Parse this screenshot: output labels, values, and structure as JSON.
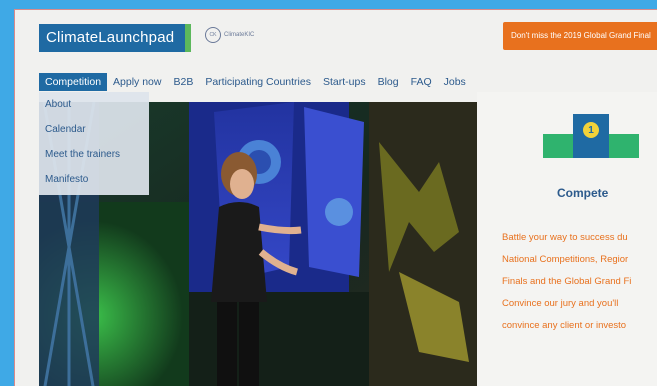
{
  "header": {
    "logo_text": "ClimateLaunchpad",
    "partner_logo_text": "ClimateKIC",
    "promo_text": "Don't miss the 2019 Global Grand Final"
  },
  "nav": {
    "items": [
      "Competition",
      "Apply now",
      "B2B",
      "Participating Countries",
      "Start-ups",
      "Blog",
      "FAQ",
      "Jobs"
    ]
  },
  "dropdown": {
    "items": [
      "About",
      "Calendar",
      "Meet the trainers",
      "Manifesto"
    ]
  },
  "compete": {
    "badge": "1",
    "title": "Compete",
    "description_lines": [
      "Battle your way to success du",
      "National Competitions, Regior",
      "Finals and the Global Grand Fi",
      "Convince our jury and you'll",
      "convince any client or investo"
    ]
  },
  "colors": {
    "background": "#3fa9e6",
    "brand_blue": "#1f6aa3",
    "brand_green": "#2fb36e",
    "orange": "#e8711e",
    "nav_text": "#2c5a8c"
  }
}
